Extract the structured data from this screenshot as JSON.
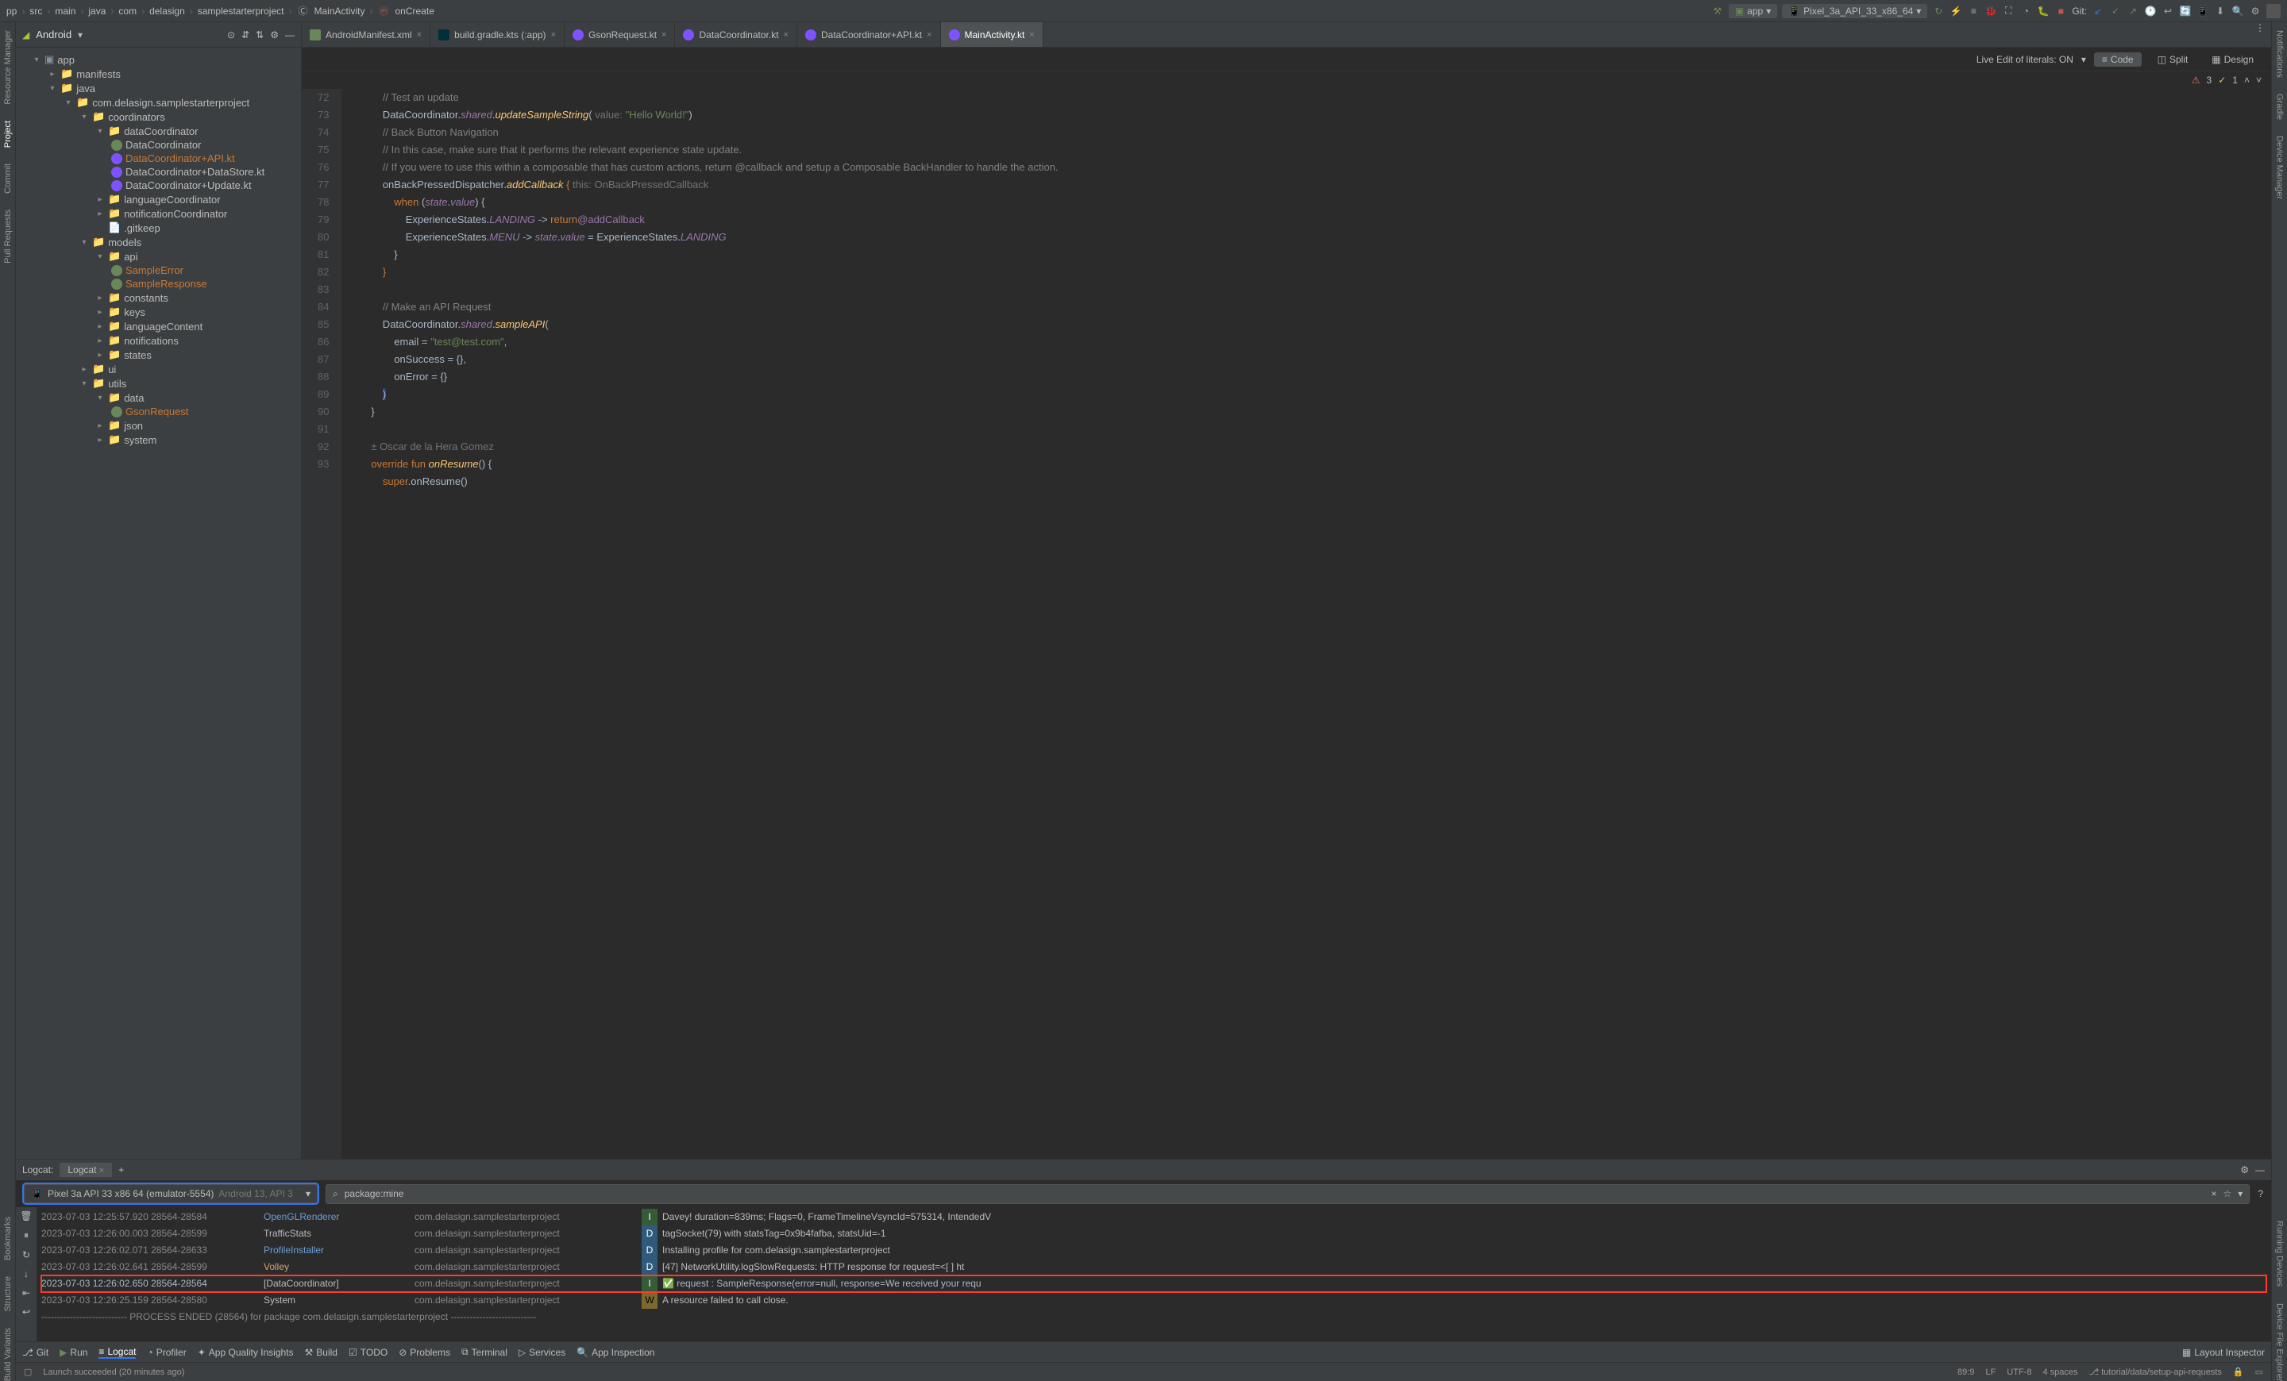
{
  "breadcrumbs": [
    "pp",
    "src",
    "main",
    "java",
    "com",
    "delasign",
    "samplestarterproject",
    "MainActivity",
    "onCreate"
  ],
  "run_config": "app",
  "device_selector": "Pixel_3a_API_33_x86_64",
  "git_label": "Git:",
  "project_dropdown": "Android",
  "left_rail": {
    "resmgr": "Resource Manager",
    "project": "Project",
    "commit": "Commit",
    "pull": "Pull Requests",
    "bookmarks": "Bookmarks",
    "structure": "Structure",
    "bv": "Build Variants"
  },
  "right_rail": {
    "notif": "Notifications",
    "gradle": "Gradle",
    "devmgr": "Device Manager",
    "emu": "Running Devices",
    "dfe": "Device File Explorer"
  },
  "editor_tabs": [
    {
      "label": "AndroidManifest.xml",
      "icon": "ic-xml"
    },
    {
      "label": "build.gradle.kts (:app)",
      "icon": "ic-gradle"
    },
    {
      "label": "GsonRequest.kt",
      "icon": "ic-kt"
    },
    {
      "label": "DataCoordinator.kt",
      "icon": "ic-kt"
    },
    {
      "label": "DataCoordinator+API.kt",
      "icon": "ic-kt"
    },
    {
      "label": "MainActivity.kt",
      "icon": "ic-kt",
      "active": true
    }
  ],
  "tree": {
    "app": "app",
    "manifests": "manifests",
    "java": "java",
    "pkg": "com.delasign.samplestarterproject",
    "coordinators": "coordinators",
    "datacoord": "dataCoordinator",
    "dc": "DataCoordinator",
    "dcapi": "DataCoordinator+API.kt",
    "dcds": "DataCoordinator+DataStore.kt",
    "dcup": "DataCoordinator+Update.kt",
    "langcoord": "languageCoordinator",
    "notifcoord": "notificationCoordinator",
    "gitkeep": ".gitkeep",
    "models": "models",
    "api": "api",
    "sampleerr": "SampleError",
    "sampleresp": "SampleResponse",
    "constants": "constants",
    "keys": "keys",
    "langcontent": "languageContent",
    "notifications": "notifications",
    "states": "states",
    "ui": "ui",
    "utils": "utils",
    "data": "data",
    "gsonreq": "GsonRequest",
    "json": "json",
    "system": "system"
  },
  "editor_info": {
    "live_edit": "Live Edit of literals: ON",
    "code": "Code",
    "split": "Split",
    "design": "Design",
    "errors": "3",
    "warnings": "1"
  },
  "code_lines": [
    {
      "n": 72,
      "html": "            <span class='cmt'>// Test an update</span>"
    },
    {
      "n": 73,
      "html": "            DataCoordinator.<span class='fld'>shared</span>.<span class='fn'>updateSampleString</span>( <span class='param'>value:</span> <span class='str'>\"Hello World!\"</span>)"
    },
    {
      "n": 74,
      "html": "            <span class='cmt'>// Back Button Navigation</span>"
    },
    {
      "n": 75,
      "html": "            <span class='cmt'>// In this case, make sure that it performs the relevant experience state update.</span>"
    },
    {
      "n": 76,
      "html": "            <span class='cmt'>// If you were to use this within a composable that has custom actions, return @callback and setup a Composable BackHandler to handle the action.</span>"
    },
    {
      "n": 77,
      "html": "            onBackPressedDispatcher.<span class='fn'>addCallback</span> <span class='kw'>{</span> <span class='param'>this: OnBackPressedCallback</span>"
    },
    {
      "n": 78,
      "html": "                <span class='kw'>when</span> (<span class='fld'>state</span>.<span class='fld'>value</span>) {"
    },
    {
      "n": 79,
      "html": "                    ExperienceStates.<span class='fld'>LANDING</span> -> <span class='kw'>return</span><span class='lbl'>@addCallback</span>"
    },
    {
      "n": 80,
      "html": "                    ExperienceStates.<span class='fld'>MENU</span> -> <span class='fld'>state</span>.<span class='fld'>value</span> = ExperienceStates.<span class='fld'>LANDING</span>"
    },
    {
      "n": 81,
      "html": "                }"
    },
    {
      "n": 82,
      "html": "            <span class='kw'>}</span>"
    },
    {
      "n": 83,
      "html": ""
    },
    {
      "n": 84,
      "html": "            <span class='cmt'>// Make an API Request</span>"
    },
    {
      "n": 85,
      "html": "            DataCoordinator.<span class='fld'>shared</span>.<span class='fn'>sampleAPI</span>("
    },
    {
      "n": 86,
      "html": "                email = <span class='str'>\"test@test.com\"</span>,"
    },
    {
      "n": 87,
      "html": "                onSuccess = {},"
    },
    {
      "n": 88,
      "html": "                onError = {}"
    },
    {
      "n": 89,
      "html": "            <span style='background:#214283'>)</span>"
    },
    {
      "n": 90,
      "html": "        }"
    },
    {
      "n": 91,
      "html": ""
    },
    {
      "n": "",
      "html": "        <span class='param'>± Oscar de la Hera Gomez</span>"
    },
    {
      "n": 92,
      "html": "        <span class='kw'>override fun</span> <span class='fn'>onResume</span>() {"
    },
    {
      "n": 93,
      "html": "            <span class='kw'>super</span>.onResume()"
    }
  ],
  "logcat": {
    "title": "Logcat:",
    "tab": "Logcat",
    "device": "Pixel 3a API 33 x86 64 (emulator-5554)",
    "device_extra": "Android 13, API 3",
    "filter": "package:mine",
    "lines": [
      {
        "ts": "2023-07-03 12:25:57.920 28564-28584",
        "tag": "OpenGLRenderer",
        "tagc": "#68a0d8",
        "pkg": "com.delasign.samplestarterproject",
        "lvl": "I",
        "msg": "Davey! duration=839ms; Flags=0, FrameTimelineVsyncId=575314, IntendedV"
      },
      {
        "ts": "2023-07-03 12:26:00.003 28564-28599",
        "tag": "TrafficStats",
        "tagc": "#bbbbbb",
        "pkg": "com.delasign.samplestarterproject",
        "lvl": "D",
        "msg": "tagSocket(79) with statsTag=0x9b4fafba, statsUid=-1"
      },
      {
        "ts": "2023-07-03 12:26:02.071 28564-28633",
        "tag": "ProfileInstaller",
        "tagc": "#68a0d8",
        "pkg": "com.delasign.samplestarterproject",
        "lvl": "D",
        "msg": "Installing profile for com.delasign.samplestarterproject"
      },
      {
        "ts": "2023-07-03 12:26:02.641 28564-28599",
        "tag": "Volley",
        "tagc": "#d0a66f",
        "pkg": "com.delasign.samplestarterproject",
        "lvl": "D",
        "msg": "[47] NetworkUtility.logSlowRequests: HTTP response for request=<[ ] ht"
      },
      {
        "ts": "2023-07-03 12:26:02.650 28564-28564",
        "tag": "[DataCoordinator]",
        "tagc": "#bbbbbb",
        "pkg": "com.delasign.samplestarterproject",
        "lvl": "I",
        "msg": "✅ request : SampleResponse(error=null, response=We received your requ",
        "hl": true
      },
      {
        "ts": "2023-07-03 12:26:25.159 28564-28580",
        "tag": "System",
        "tagc": "#bbbbbb",
        "pkg": "com.delasign.samplestarterproject",
        "lvl": "W",
        "msg": "A resource failed to call close."
      },
      {
        "ts": "--------------------------- PROCESS ENDED (28564) for package com.delasign.samplestarterproject ---------------------------",
        "plain": true
      }
    ]
  },
  "bottom_tabs": {
    "git": "Git",
    "run": "Run",
    "logcat": "Logcat",
    "profiler": "Profiler",
    "aqi": "App Quality Insights",
    "build": "Build",
    "todo": "TODO",
    "problems": "Problems",
    "terminal": "Terminal",
    "services": "Services",
    "appinsp": "App Inspection",
    "layoutinsp": "Layout Inspector"
  },
  "status": {
    "launch": "Launch succeeded (20 minutes ago)",
    "pos": "89:9",
    "lf": "LF",
    "enc": "UTF-8",
    "indent": "4 spaces",
    "branch": "tutorial/data/setup-api-requests"
  }
}
